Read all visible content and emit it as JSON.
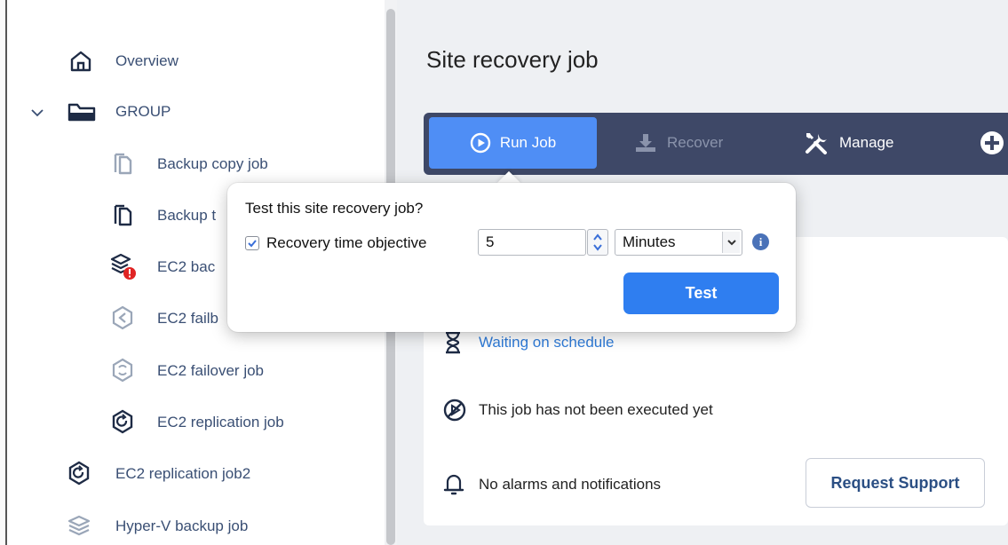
{
  "sidebar": {
    "items": [
      {
        "label": "Overview",
        "icon": "home-icon"
      },
      {
        "label": "GROUP",
        "icon": "folder-open-icon"
      },
      {
        "label": "Backup copy job",
        "icon": "copy-job-icon"
      },
      {
        "label": "Backup t",
        "icon": "copy-job-icon"
      },
      {
        "label": "EC2 bac",
        "icon": "ec2-backup-error-icon"
      },
      {
        "label": "EC2 failb",
        "icon": "ec2-failback-icon"
      },
      {
        "label": "EC2 failover job",
        "icon": "ec2-failover-icon"
      },
      {
        "label": "EC2 replication job",
        "icon": "ec2-replication-icon"
      },
      {
        "label": "EC2 replication job2",
        "icon": "ec2-replication-icon"
      },
      {
        "label": "Hyper-V backup job",
        "icon": "stack-layers-icon"
      }
    ]
  },
  "main": {
    "title": "Site recovery job",
    "toolbar": {
      "run_job": "Run Job",
      "recover": "Recover",
      "manage": "Manage"
    },
    "status": {
      "schedule": "Waiting on schedule",
      "execution": "This job has not been executed yet",
      "alarms": "No alarms and notifications"
    },
    "request_support": "Request Support"
  },
  "popover": {
    "question": "Test this site recovery job?",
    "checkbox_label": "Recovery time objective",
    "checkbox_checked": true,
    "rto_value": "5",
    "unit": "Minutes",
    "test_button": "Test"
  },
  "colors": {
    "toolbar_bg": "#3e4867",
    "primary": "#4f8ef5",
    "test_button": "#2f7ef0",
    "link": "#2f7bd8",
    "error": "#e02424"
  }
}
